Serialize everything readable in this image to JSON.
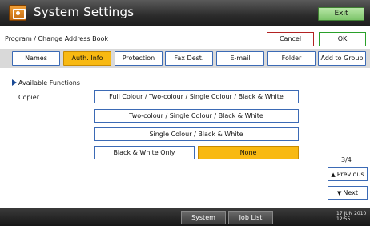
{
  "header": {
    "title": "System Settings",
    "exit_label": "Exit"
  },
  "subheader": {
    "label": "Program / Change Address Book",
    "cancel_label": "Cancel",
    "ok_label": "OK"
  },
  "tabs": [
    {
      "label": "Names",
      "active": false
    },
    {
      "label": "Auth. Info",
      "active": true
    },
    {
      "label": "Protection",
      "active": false
    },
    {
      "label": "Fax Dest.",
      "active": false
    },
    {
      "label": "E-mail",
      "active": false
    },
    {
      "label": "Folder",
      "active": false
    },
    {
      "label": "Add to Group",
      "active": false
    }
  ],
  "section": {
    "heading": "Available Functions",
    "category": "Copier"
  },
  "options": [
    {
      "label": "Full Colour / Two-colour / Single Colour / Black & White",
      "selected": false
    },
    {
      "label": "Two-colour / Single Colour / Black & White",
      "selected": false
    },
    {
      "label": "Single Colour / Black & White",
      "selected": false
    },
    {
      "label": "Black & White Only",
      "selected": false
    },
    {
      "label": "None",
      "selected": true
    }
  ],
  "pagination": {
    "indicator": "3/4",
    "previous_label": "Previous",
    "next_label": "Next"
  },
  "statusbar": {
    "system_status_label": "System Status",
    "job_list_label": "Job List",
    "date": "17 JUN  2010",
    "time": "12:55"
  },
  "colors": {
    "selected": "#f8b912",
    "button_border": "#3b6ab5",
    "exit_green": "#7cc46a",
    "cancel_red": "#b22222",
    "ok_green": "#2aa02a"
  }
}
